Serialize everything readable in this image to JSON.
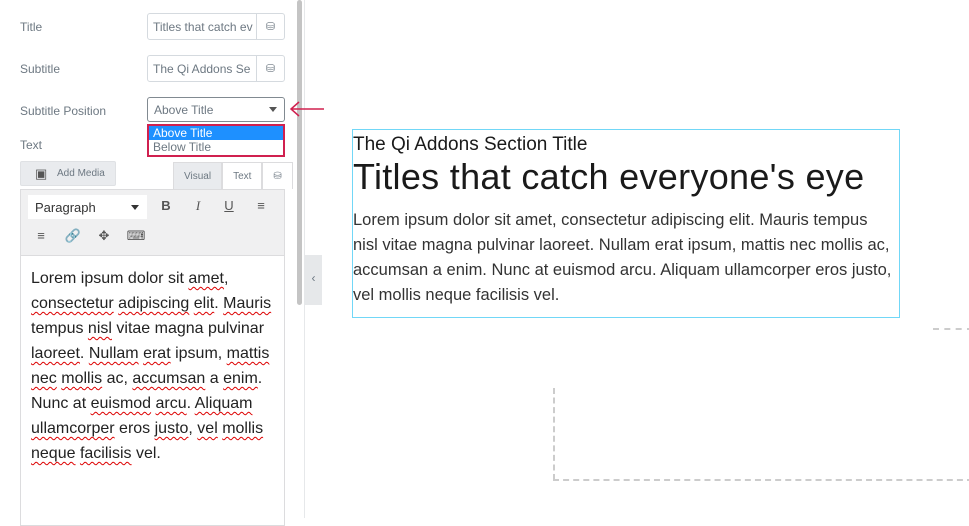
{
  "panel": {
    "title_label": "Title",
    "title_value": "Titles that catch ev",
    "subtitle_label": "Subtitle",
    "subtitle_value": "The Qi Addons Se",
    "position_label": "Subtitle Position",
    "position_value": "Above Title",
    "position_options": [
      "Above Title",
      "Below Title"
    ],
    "text_label": "Text",
    "add_media": "Add Media",
    "tabs": [
      "Visual",
      "Text"
    ],
    "format": "Paragraph",
    "editor_words": [
      "Lorem ipsum dolor sit ",
      "amet",
      ", ",
      "consectetur",
      " ",
      "adipiscing",
      " ",
      "elit",
      ". ",
      "Mauris",
      " tempus ",
      "nisl",
      " vitae magna pulvinar ",
      "laoreet",
      ". ",
      "Nullam",
      " ",
      "erat",
      " ipsum, ",
      "mattis",
      " ",
      "nec",
      " ",
      "mollis",
      " ac, ",
      "accumsan",
      " a ",
      "enim",
      ". Nunc at ",
      "euismod",
      " ",
      "arcu",
      ". ",
      "Aliquam",
      " ",
      "ullamcorper",
      " eros ",
      "justo",
      ", ",
      "vel",
      " ",
      "mollis",
      " ",
      "neque",
      " ",
      "facilisis",
      " vel."
    ]
  },
  "preview": {
    "subtitle": "The Qi Addons Section Title",
    "title": "Titles that catch everyone's eye",
    "text": "Lorem ipsum dolor sit amet, consectetur adipiscing elit. Mauris tempus nisl vitae magna pulvinar laoreet. Nullam erat ipsum, mattis nec mollis ac, accumsan a enim. Nunc at euismod arcu. Aliquam ullamcorper eros justo, vel mollis neque facilisis vel."
  },
  "colors": {
    "highlight": "#d0204f",
    "selected": "#1e90ff",
    "widget_border": "#71d7f7"
  }
}
